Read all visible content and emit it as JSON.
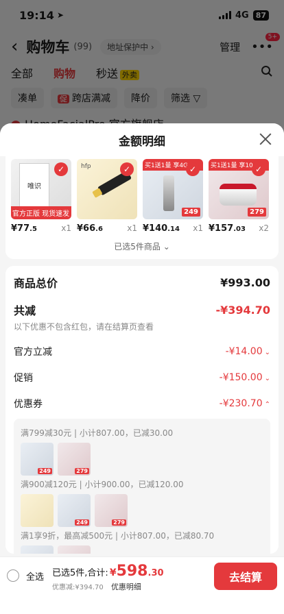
{
  "status": {
    "time": "19:14",
    "network": "4G",
    "battery": "87"
  },
  "cart": {
    "title": "购物车",
    "count": "(99)",
    "address": "地址保护中",
    "manage": "管理",
    "more_badge": "5+",
    "tabs": [
      "全部",
      "购物",
      "秒送"
    ],
    "sale_tag": "外卖",
    "filters": [
      "凑单",
      "跨店满减",
      "降价",
      "筛选"
    ],
    "filter_promo": "促",
    "shop_name": "HomeFacialPro 官方旗舰店"
  },
  "sheet": {
    "title": "金额明细",
    "products": [
      {
        "price": "¥77",
        "cents": ".5",
        "qty": "x1",
        "ribbon": "官方正版 现货速发",
        "book_title": "唯识"
      },
      {
        "price": "¥66",
        "cents": ".6",
        "qty": "x1",
        "brand": "hfp"
      },
      {
        "price": "¥140",
        "cents": ".14",
        "qty": "x1",
        "top": "买1送1量 享4G",
        "badge": "249"
      },
      {
        "price": "¥157",
        "cents": ".03",
        "qty": "x2",
        "top": "买1送1量 享10",
        "badge": "279"
      }
    ],
    "selected_count": "已选5件商品"
  },
  "detail": {
    "total_label": "商品总价",
    "total_value": "¥993.00",
    "reduce_label": "共减",
    "reduce_value": "-¥394.70",
    "note": "以下优惠不包含红包，请在结算页查看",
    "rows": [
      {
        "label": "官方立减",
        "value": "-¥14.00"
      },
      {
        "label": "促销",
        "value": "-¥150.00"
      },
      {
        "label": "优惠券",
        "value": "-¥230.70"
      }
    ],
    "coupon_lines": [
      "满799减30元 | 小计807.00，已减30.00",
      "满900减120元 | 小计900.00，已减120.00",
      "满1享9折，最高减500元 | 小计807.00，已减80.70"
    ],
    "badges": [
      "249",
      "279"
    ]
  },
  "bottom": {
    "select_all": "全选",
    "selected": "已选5件,合计:",
    "yen": "¥",
    "amount": "598",
    "cents": ".30",
    "discount": "优惠减:¥394.70",
    "detail_link": "优惠明细",
    "checkout": "去结算"
  },
  "colors": {
    "accent": "#e4393c"
  }
}
